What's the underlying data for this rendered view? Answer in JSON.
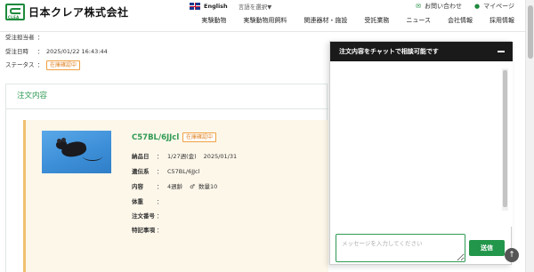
{
  "header": {
    "brand": "日本クレア株式会社",
    "brand_mark": "CLEA",
    "language": "English",
    "language_select": "言語を選択▼",
    "contact": "お問い合わせ",
    "mypage": "マイページ",
    "nav": [
      "実験動物",
      "実験動物用飼料",
      "関連器材・施設",
      "受託業務",
      "ニュース",
      "会社情報",
      "採用情報"
    ]
  },
  "order": {
    "handler_label": "受注担当者",
    "handler_value": "",
    "date_label": "受注日時",
    "date_value": "2025/01/22 16:43:44",
    "status_label": "ステータス",
    "status_value": "在庫確認中"
  },
  "section": {
    "title": "注文内容"
  },
  "product": {
    "name": "C57BL/6JJcl",
    "badge": "在庫確認中",
    "delivery_label": "納品日",
    "delivery_week": "1/27週(金)",
    "delivery_date": "2025/01/31",
    "strain_label": "遺伝系",
    "strain_value": "C57BL/6JJcl",
    "content_label": "内容",
    "content_age": "4週齢",
    "content_sex": "♂",
    "content_qty": "数量10",
    "weight_label": "体重",
    "order_no_label": "注文番号",
    "notes_label": "特記事項"
  },
  "chat": {
    "title": "注文内容をチャットで相談可能です",
    "placeholder": "メッセージを入力してください",
    "send": "送信"
  },
  "colors": {
    "brand_green": "#2f9a53",
    "status_orange": "#e08020",
    "card_bg": "#fdf7ea",
    "chat_header": "#1a1a1a"
  }
}
